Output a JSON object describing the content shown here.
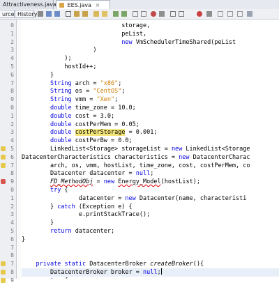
{
  "tabs": [
    {
      "label": "Attractiveness.java",
      "close": "×"
    },
    {
      "label": "EES.java",
      "close": "×"
    }
  ],
  "toolbar": {
    "source_label": "urce",
    "history_label": "History"
  },
  "colors": {
    "keyword": "#0000e6",
    "string": "#ce7b00",
    "highlight": "#f4e67a",
    "gutter": "#eeeff2"
  },
  "lines": [
    {
      "n": "0",
      "t": "                            storage,"
    },
    {
      "n": "1",
      "t": "                            peList,"
    },
    {
      "n": "2",
      "t": "                            new VmSchedulerTimeShared(peList"
    },
    {
      "n": "3",
      "t": "                    )"
    },
    {
      "n": "4",
      "t": "            );"
    },
    {
      "n": "5",
      "t": "            hostId++;"
    },
    {
      "n": "6",
      "t": "        }"
    },
    {
      "n": "7",
      "t": "        String arch = \"x86\";"
    },
    {
      "n": "8",
      "t": "        String os = \"CentOS\";"
    },
    {
      "n": "9",
      "t": "        String vmm = \"Xen\";"
    },
    {
      "n": "0",
      "t": "        double time_zone = 10.0;"
    },
    {
      "n": "1",
      "t": "        double cost = 3.0;"
    },
    {
      "n": "2",
      "t": "        double costPerMem = 0.05;"
    },
    {
      "n": "3",
      "t": "        double costPerStorage = 0.001;"
    },
    {
      "n": "4",
      "t": "        double costPerBw = 0.0;"
    },
    {
      "n": "5",
      "t": "        LinkedList<Storage> storageList = new LinkedList<Storage"
    },
    {
      "n": "6",
      "t": "DatacenterCharacteristics characteristics = new DatacenterCharac"
    },
    {
      "n": "7",
      "t": "        arch, os, vmm, hostList, time_zone, cost, costPerMem, co"
    },
    {
      "n": "8",
      "t": "        Datacenter datacenter = null;"
    },
    {
      "n": "9",
      "t": "        FD_MethodObj = new Energy_Model(hostList);"
    },
    {
      "n": "0",
      "t": "        try {"
    },
    {
      "n": "1",
      "t": "                datacenter = new Datacenter(name, characteristi"
    },
    {
      "n": "2",
      "t": "        } catch (Exception e) {"
    },
    {
      "n": "3",
      "t": "                e.printStackTrace();"
    },
    {
      "n": "4",
      "t": "        }"
    },
    {
      "n": "5",
      "t": "        return datacenter;"
    },
    {
      "n": "6",
      "t": "}"
    },
    {
      "n": "7",
      "t": ""
    },
    {
      "n": "8",
      "t": ""
    },
    {
      "n": "7",
      "t": "    private static DatacenterBroker createBroker(){"
    },
    {
      "n": "8",
      "t": "        DatacenterBroker broker = null;"
    },
    {
      "n": "9",
      "t": "        try {"
    }
  ]
}
